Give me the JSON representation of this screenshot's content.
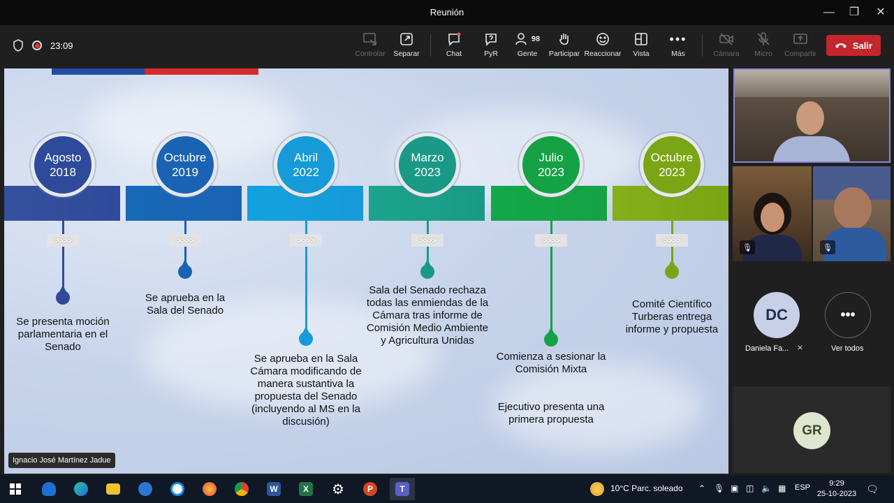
{
  "window": {
    "title": "Reunión"
  },
  "toolbar": {
    "timer": "23:09",
    "buttons": {
      "controlar": "Controlar",
      "separar": "Separar",
      "chat": "Chat",
      "pyr": "PyR",
      "gente": "Gente",
      "gente_count": "98",
      "participar": "Participar",
      "reaccionar": "Reaccionar",
      "vista": "Vista",
      "mas": "Más",
      "camara": "Cámara",
      "micro": "Micro",
      "compartir": "Compartir"
    },
    "leave_label": "Salir"
  },
  "slide": {
    "milestones": [
      {
        "month": "Agosto",
        "year": "2018",
        "text": "Se presenta moción parlamentaria en el Senado",
        "color": "#2f4a9a",
        "band": "#34509e"
      },
      {
        "month": "Octubre",
        "year": "2019",
        "text": "Se aprueba en la Sala del Senado",
        "color": "#1a63b4",
        "band": "#1868b8"
      },
      {
        "month": "Abril",
        "year": "2022",
        "text": "Se aprueba en la Sala Cámara modificando de manera sustantiva la propuesta del Senado (incluyendo al MS en la discusión)",
        "color": "#169ad8",
        "band": "#13a1e0"
      },
      {
        "month": "Marzo",
        "year": "2023",
        "text": "Sala del Senado rechaza todas las enmiendas de la Cámara tras informe de Comisión Medio Ambiente y Agricultura Unidas",
        "color": "#1a9a86",
        "band": "#1ca38f"
      },
      {
        "month": "Julio",
        "year": "2023",
        "text": "Comienza a sesionar la Comisión Mixta",
        "text2": "Ejecutivo presenta una primera propuesta",
        "color": "#14a244",
        "band": "#13a848"
      },
      {
        "month": "Octubre",
        "year": "2023",
        "text": "Comité Científico Turberas entrega informe y propuesta",
        "color": "#7aa514",
        "band": "#86b01a"
      }
    ],
    "chevron": ">>>>",
    "flag_colors": [
      "#1f4ea3",
      "#d52b2b"
    ]
  },
  "presenter_label": "Ignacio José Martínez Jadue",
  "participants": {
    "dc": {
      "initials": "DC",
      "name": "Daniela Fa..."
    },
    "ver_todos": "Ver todos",
    "gr": {
      "initials": "GR"
    }
  },
  "taskbar": {
    "weather": "10°C  Parc. soleado",
    "lang": "ESP",
    "time": "9:29",
    "date": "25-10-2023"
  }
}
